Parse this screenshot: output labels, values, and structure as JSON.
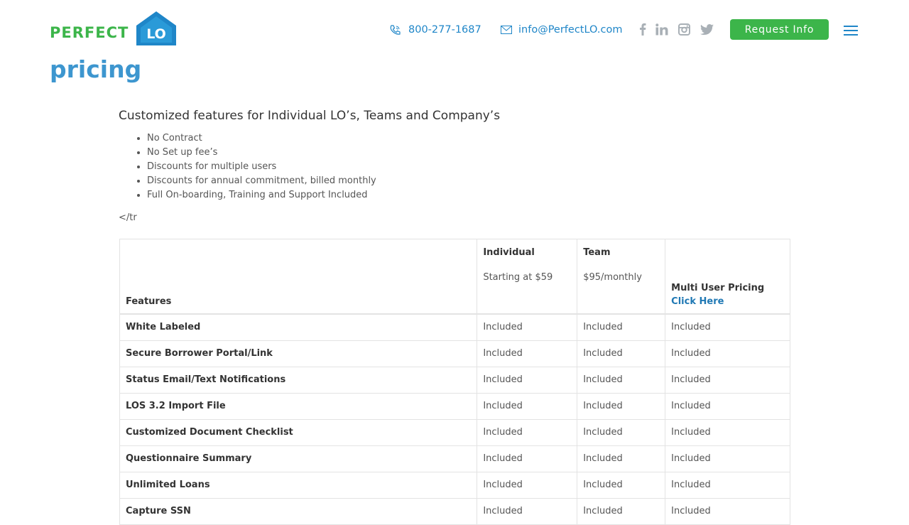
{
  "header": {
    "logo": {
      "word": "PERFECT",
      "mark": "LO"
    },
    "phone": "800-277-1687",
    "email": "info@PerfectLO.com",
    "social": [
      "facebook-icon",
      "linkedin-icon",
      "instagram-icon",
      "twitter-icon"
    ],
    "request_button": "Request Info",
    "menu_icon": "hamburger-menu-icon"
  },
  "colors": {
    "brand_green": "#3cb54a",
    "brand_blue": "#1f86c8",
    "title_blue": "#3d96cf",
    "social_gray": "#a9b0b6"
  },
  "page": {
    "title": "pricing",
    "subtitle": "Customized features for Individual LO’s, Teams and Company’s",
    "bullets": [
      "No Contract",
      "No Set up fee’s",
      "Discounts for multiple users",
      "Discounts for annual commitment, billed monthly",
      "Full On-boarding, Training and Support Included"
    ],
    "stray_text": "</tr"
  },
  "pricing_table": {
    "headers": {
      "features": "Features",
      "individual": {
        "name": "Individual",
        "price": "Starting at $59"
      },
      "team": {
        "name": "Team",
        "price": "$95/monthly"
      },
      "multi": {
        "name": "Multi User Pricing",
        "link": "Click Here"
      }
    },
    "rows": [
      {
        "feature": "White Labeled",
        "individual": "Included",
        "team": "Included",
        "multi": "Included"
      },
      {
        "feature": "Secure Borrower Portal/Link",
        "individual": "Included",
        "team": "Included",
        "multi": "Included"
      },
      {
        "feature": "Status Email/Text Notifications",
        "individual": "Included",
        "team": "Included",
        "multi": "Included"
      },
      {
        "feature": "LOS 3.2 Import File",
        "individual": "Included",
        "team": "Included",
        "multi": "Included"
      },
      {
        "feature": "Customized Document Checklist",
        "individual": "Included",
        "team": "Included",
        "multi": "Included"
      },
      {
        "feature": "Questionnaire Summary",
        "individual": "Included",
        "team": "Included",
        "multi": "Included"
      },
      {
        "feature": "Unlimited Loans",
        "individual": "Included",
        "team": "Included",
        "multi": "Included"
      },
      {
        "feature": "Capture SSN",
        "individual": "Included",
        "team": "Included",
        "multi": "Included"
      }
    ]
  }
}
